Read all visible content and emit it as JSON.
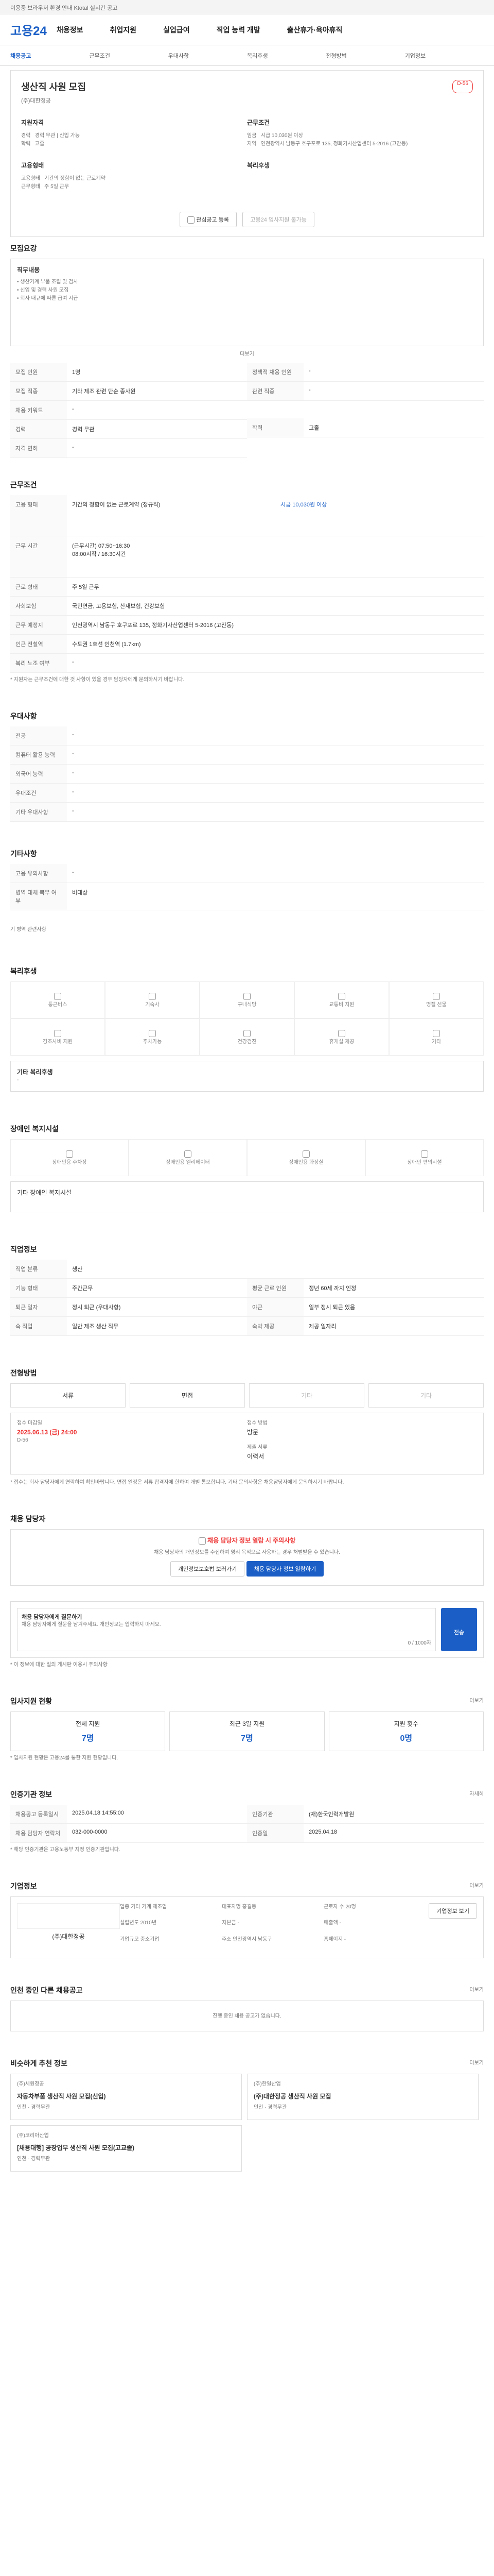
{
  "topbar": {
    "text": "이용중 브라우저 환경 안내 Ktotal 실시간 공고"
  },
  "logo": "고용24",
  "gnb": [
    "채용정보",
    "취업지원",
    "실업급여",
    "직업 능력 개발",
    "출산휴가·육아휴직"
  ],
  "sub": [
    "채용공고",
    "근무조건",
    "우대사항",
    "복리후생",
    "전형방법",
    "기업정보"
  ],
  "job": {
    "title": "생산직 사원 모집",
    "badge": "D-56",
    "company": "(주)대한정공",
    "left_label": "지원자격",
    "right_label": "근무조건",
    "exp_k": "경력",
    "exp_v": "경력 무관 | 신입 가능",
    "edu_k": "학력",
    "edu_v": "고졸",
    "wage_k": "임금",
    "wage_v": "시급 10,030원 이상",
    "area_k": "지역",
    "area_v": "인천광역시 남동구 호구포로 135, 정화기사산업센터 5-2016 (고잔동)",
    "emp_label": "고용형태",
    "work_label": "복리후생",
    "emp_k": "고용형태",
    "emp_v": "기간의 정함이 없는 근로계약",
    "work_k": "근무형태",
    "work_v": "주 5일 근무",
    "btn_scrap": "관심공고 등록",
    "btn_apply": "고용24 입사지원 불가능"
  },
  "s1": {
    "title": "모집요강",
    "sub": "직무내용",
    "content": "• 생산기계 부품 조립 및 검사\n• 신입 및 경력 사원 모집\n• 회사 내규에 따른 급여 지급",
    "more": "더보기",
    "rows": [
      [
        "모집 인원",
        "1명"
      ],
      [
        "모집 직종",
        "기타 제조 관련 단순 종사원"
      ],
      [
        "채용 키워드",
        "-"
      ],
      [
        "경력",
        "경력 무관"
      ],
      [
        "자격 면허",
        "-"
      ]
    ],
    "rows_r": [
      [
        "정책적 채용 인원",
        "-"
      ],
      [
        "관련 직종",
        "-"
      ],
      [
        "학력",
        "고졸"
      ]
    ]
  },
  "s2": {
    "title": "근무조건",
    "rows": [
      [
        "고용 형태",
        "기간의 정함이 없는 근로계약 (정규직)"
      ],
      [
        "근무 시간",
        "(근무시간) 07:50~16:30"
      ],
      [
        "근무 시간",
        "08:00시작 / 16:30시간"
      ],
      [
        "근로 형태",
        "주 5일 근무"
      ],
      [
        "사회보험",
        "국민연금, 고용보험, 산재보험, 건강보험"
      ],
      [
        "근무 예정지",
        "인천광역시 남동구 호구포로 135, 정화기사산업센터 5-2016 (고잔동)"
      ],
      [
        "인근 전철역",
        "수도권 1호선 인천역 (1.7km)"
      ],
      [
        "복리 노조 여부",
        "-"
      ]
    ],
    "wage": "시급 10,030원 이상",
    "note": "* 지원자는 근무조건에 대한 것 사항이 있을 경우 담당자에게 문의하시기 바랍니다."
  },
  "s3": {
    "title": "우대사항",
    "rows": [
      [
        "전공",
        "-"
      ],
      [
        "컴퓨터 활용 능력",
        "-"
      ],
      [
        "외국어 능력",
        "-"
      ],
      [
        "우대조건",
        "-"
      ],
      [
        "기타 우대사항",
        "-"
      ]
    ]
  },
  "s4": {
    "title": "기타사항",
    "rows": [
      [
        "고용 유의사항",
        "-"
      ],
      [
        "병역 대체 복무 여부",
        "비대상"
      ]
    ],
    "extra": "기 병역 관련사항"
  },
  "s5": {
    "title": "복리후생",
    "items": [
      "통근버스",
      "기숙사",
      "구내식당",
      "교통비 지원",
      "명절 선물",
      "경조사비 지원",
      "주차가능",
      "건강검진",
      "휴게실 제공",
      "기타"
    ],
    "other_title": "기타 복리후생",
    "other": "-"
  },
  "s6": {
    "title": "장애인 복지시설",
    "items": [
      "장애인용 주차장",
      "장애인용 엘리베이터",
      "장애인용 화장실",
      "장애인 편의시설"
    ],
    "other": "기타 장애인 복지시설"
  },
  "s7": {
    "title": "직업정보",
    "rows": [
      [
        "직업 분류",
        "생산"
      ],
      [
        "기능 형태",
        "주간근무",
        "평균 근로 인원",
        "정년 60세 까지 인정"
      ],
      [
        "퇴근 일자",
        "정시 퇴근 (우대사항)",
        "야근",
        "일부 정시 퇴근 있음"
      ],
      [
        "숙 직업",
        "일반 제조 생산 직무",
        "숙박 제공",
        "제공 일자리"
      ]
    ]
  },
  "s8": {
    "title": "전형방법",
    "steps": [
      "서류",
      "면접",
      "기타",
      "기타"
    ],
    "deadline_k": "접수 마감일",
    "deadline_v": "2025.06.13 (금) 24:00",
    "deadline_sub": "D-56",
    "method_k": "접수 방법",
    "method_v": "방문",
    "docs_k": "제출 서류",
    "docs_v": "이력서",
    "notes": "* 접수는 회사 담당자에게 연락하여 확인바랍니다. 면접 일정은 서류 합격자에 한하여 개별 통보합니다. 기타 문의사항은 채용담당자에게 문의하시기 바랍니다."
  },
  "s9": {
    "title": "채용 담당자",
    "alert": "채용 담당자 정보 열람 시 주의사항",
    "alert_text": "채용 담당자의 개인정보를 수집하여 영리 목적으로 사용하는 경우 처벌받을 수 있습니다.",
    "btn1": "개인정보보호법 보러가기",
    "btn2": "채용 담당자 정보 열람하기"
  },
  "s10": {
    "title": "채용 담당자에게 질문하기",
    "placeholder": "채용 담당자에게 질문을 남겨주세요. 개인정보는 입력하지 마세요.",
    "count": "0 / 1000자",
    "send": "전송",
    "note": "* 이 정보에 대한 질의 게시판 이용시 주의사항"
  },
  "s11": {
    "title": "입사지원 현황",
    "more": "더보기",
    "stats": [
      [
        "전체 지원",
        "7명"
      ],
      [
        "최근 3일 지원",
        "7명"
      ],
      [
        "지원 횟수",
        "0명"
      ]
    ],
    "note": "* 입사지원 현황은 고용24를 통한 지원 현황입니다."
  },
  "s12": {
    "title": "인증기관 정보",
    "more": "자세히",
    "rows": [
      [
        "채용공고 등록일시",
        "2025.04.18 14:55:00",
        "인증기관",
        "(재)한국인력개발원"
      ],
      [
        "채용 담당자 연락처",
        "032-000-0000",
        "인증일",
        "2025.04.18"
      ]
    ],
    "note": "* 해당 인증기관은 고용노동부 지정 인증기관입니다."
  },
  "s13": {
    "title": "기업정보",
    "more": "더보기",
    "name": "(주)대한정공",
    "fields": [
      [
        "업종",
        "기타 기계 제조업"
      ],
      [
        "대표자명",
        "홍길동"
      ],
      [
        "근로자 수",
        "20명"
      ],
      [
        "설립년도",
        "2010년"
      ],
      [
        "자본금",
        "-"
      ],
      [
        "매출액",
        "-"
      ],
      [
        "기업규모",
        "중소기업"
      ],
      [
        "주소",
        "인천광역시 남동구"
      ],
      [
        "홈페이지",
        "-"
      ]
    ],
    "btn": "기업정보 보기"
  },
  "s14": {
    "title": "인천 중인 다른 채용공고",
    "more": "더보기",
    "empty": "진행 중인 채용 공고가 없습니다."
  },
  "s15": {
    "title": "비슷하게 추천 정보",
    "more": "더보기",
    "cards": [
      [
        "(주)세원정공",
        "자동차부품 생산직 사원 모집(신입)",
        "인천",
        "경력무관"
      ],
      [
        "(주)한일산업",
        "(주)대한정공 생산직 사원 모집",
        "인천",
        "경력무관"
      ],
      [
        "(주)코리아산업",
        "[채용대행] 공장업무 생산직 사원 모집(고교졸)",
        "인천",
        "경력무관"
      ]
    ]
  }
}
